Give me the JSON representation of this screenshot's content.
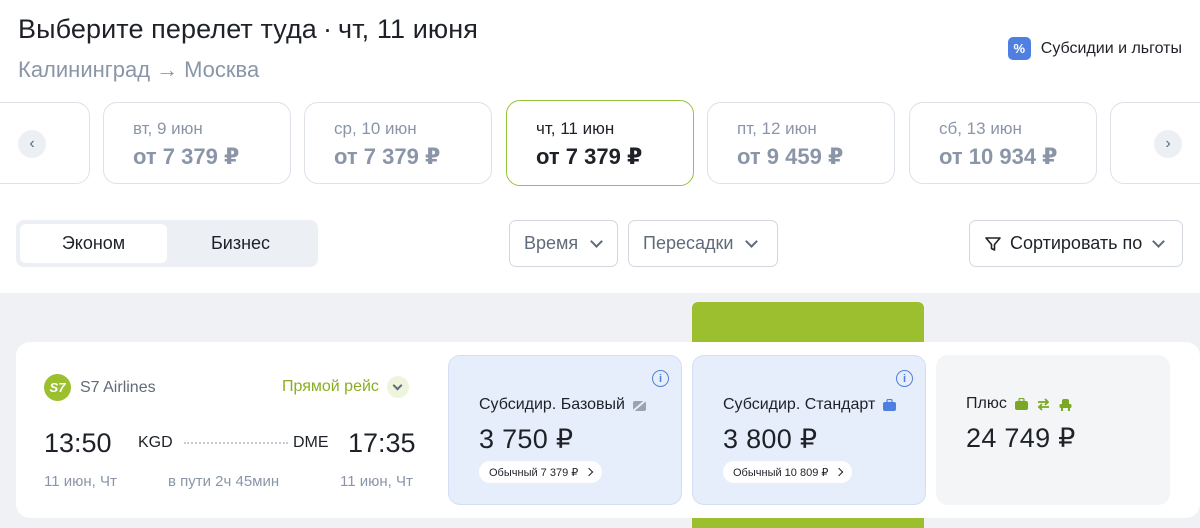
{
  "header": {
    "title": "Выберите перелет туда",
    "separator": "·",
    "date": "чт, 11 июня",
    "route_from": "Калининград",
    "route_arrow": "→",
    "route_to": "Москва",
    "subsidy_icon": "%",
    "subsidy_label": "Субсидии и льготы"
  },
  "dates": [
    {
      "day": "вт, 9 июн",
      "price": "от 7 379 ₽"
    },
    {
      "day": "ср, 10 июн",
      "price": "от 7 379 ₽"
    },
    {
      "day": "чт, 11 июн",
      "price": "от 7 379 ₽",
      "selected": true
    },
    {
      "day": "пт, 12 июн",
      "price": "от 9 459 ₽"
    },
    {
      "day": "сб, 13 июн",
      "price": "от 10 934 ₽"
    }
  ],
  "nav": {
    "prev": "‹",
    "next": "›"
  },
  "class_switch": {
    "economy": "Эконом",
    "business": "Бизнес",
    "selected": "economy"
  },
  "filters": {
    "time": "Время",
    "transfers": "Пересадки",
    "sort": "Сортировать по"
  },
  "flight": {
    "airline": "S7 Airlines",
    "logo_text": "S7",
    "direct_label": "Прямой рейс",
    "dep_time": "13:50",
    "dep_code": "KGD",
    "arr_code": "DME",
    "arr_time": "17:35",
    "dep_date": "11 июн, Чт",
    "duration": "в пути 2ч 45мин",
    "arr_date": "11 июн, Чт"
  },
  "fares": [
    {
      "name": "Субсидир. Базовый",
      "price": "3 750 ₽",
      "regular": "Обычный 7 379 ₽",
      "icon": "no-baggage-icon"
    },
    {
      "name": "Субсидир. Стандарт",
      "price": "3 800 ₽",
      "regular": "Обычный 10 809 ₽",
      "icon": "baggage-icon"
    },
    {
      "name": "Плюс",
      "price": "24 749 ₽",
      "icons": [
        "baggage-icon",
        "exchange-icon",
        "seat-icon"
      ]
    }
  ],
  "colors": {
    "accent_green": "#9bbf2e",
    "subsidy_blue": "#4f7fe0",
    "sub_fare_bg": "#e7eefb"
  }
}
